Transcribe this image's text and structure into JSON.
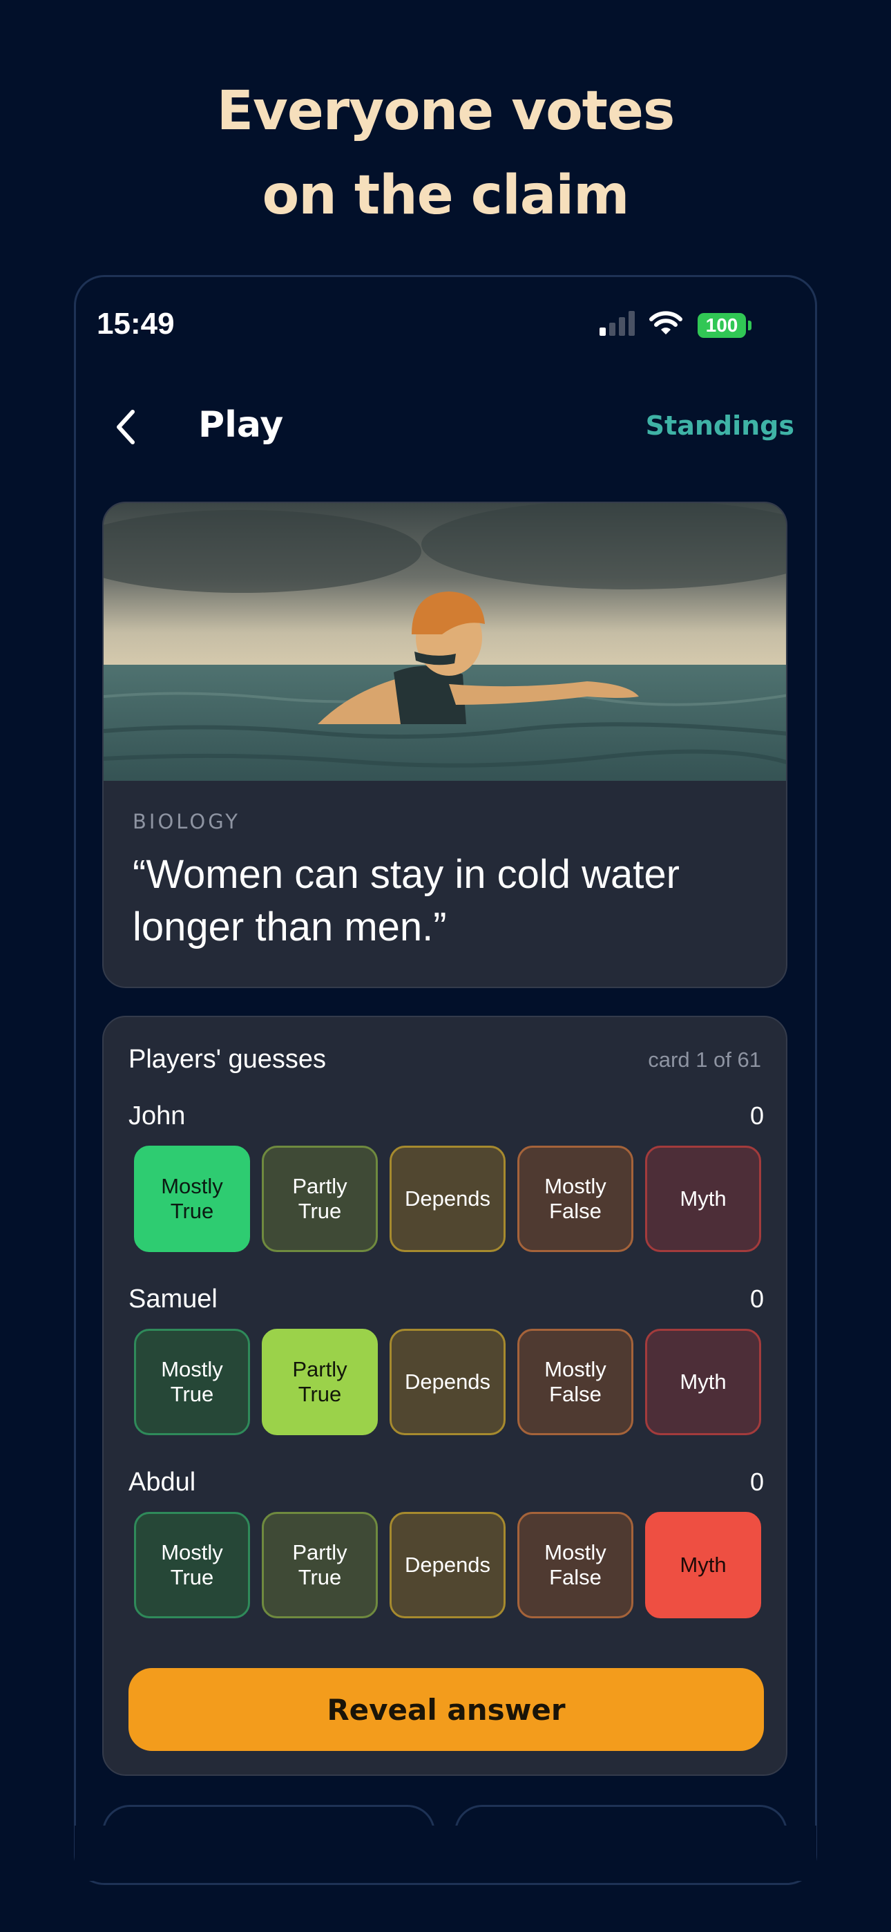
{
  "headline": {
    "line1": "Everyone votes",
    "line2": "on the claim"
  },
  "status_bar": {
    "time": "15:49",
    "battery": "100",
    "icons": [
      "signal-icon",
      "wifi-icon",
      "battery-icon"
    ]
  },
  "nav": {
    "title": "Play",
    "standings": "Standings"
  },
  "claim": {
    "category": "BIOLOGY",
    "text": "“Women can stay in cold water longer than men.”"
  },
  "guesses": {
    "title": "Players' guesses",
    "card_count": "card 1 of 61",
    "option_labels": [
      "Mostly\nTrue",
      "Partly\nTrue",
      "Depends",
      "Mostly\nFalse",
      "Myth"
    ],
    "players": [
      {
        "name": "John",
        "score": "0",
        "selected": "Mostly True"
      },
      {
        "name": "Samuel",
        "score": "0",
        "selected": "Partly True"
      },
      {
        "name": "Abdul",
        "score": "0",
        "selected": "Myth"
      }
    ]
  },
  "reveal_button": "Reveal answer",
  "colors": {
    "background": "#02102a",
    "card": "#242a38",
    "headline": "#f6dfbc",
    "accent_teal": "#3fb3a6",
    "reveal": "#f39c1c"
  }
}
